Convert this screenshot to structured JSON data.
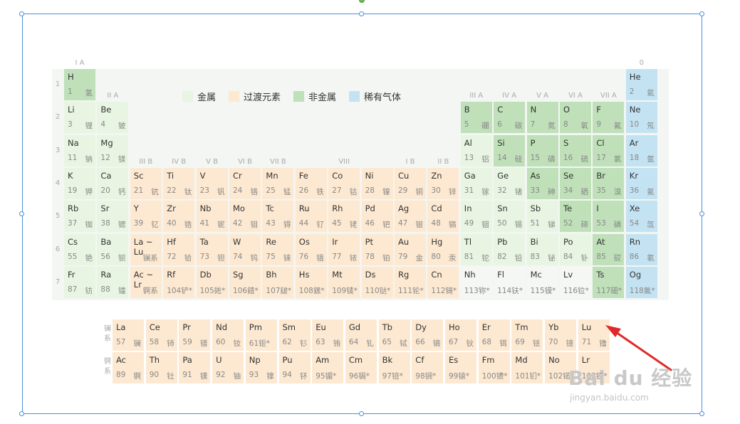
{
  "legend": [
    {
      "label": "金属",
      "color": "#e8f5e3"
    },
    {
      "label": "过渡元素",
      "color": "#fde9d1"
    },
    {
      "label": "非金属",
      "color": "#bfe0b9"
    },
    {
      "label": "稀有气体",
      "color": "#c3e3f3"
    }
  ],
  "group_labels": {
    "g1": "I A",
    "g2": "II A",
    "g3": "III B",
    "g4": "IV B",
    "g5": "V B",
    "g6": "VI B",
    "g7": "VII B",
    "g8": "VIII",
    "g11": "I B",
    "g12": "II B",
    "g13": "III A",
    "g14": "IV A",
    "g15": "V A",
    "g16": "VI A",
    "g17": "VII A",
    "g18": "0"
  },
  "periods": [
    "1",
    "2",
    "3",
    "4",
    "5",
    "6",
    "7"
  ],
  "series_labels": {
    "lanthanide": "镧系",
    "actinide": "锕系"
  },
  "elements": [
    {
      "symbol": "H",
      "number": "1",
      "name": "氢",
      "col": 1,
      "row": 1,
      "cat": "nonmetal"
    },
    {
      "symbol": "He",
      "number": "2",
      "name": "氦",
      "col": 18,
      "row": 1,
      "cat": "noble"
    },
    {
      "symbol": "Li",
      "number": "3",
      "name": "锂",
      "col": 1,
      "row": 2,
      "cat": "metal"
    },
    {
      "symbol": "Be",
      "number": "4",
      "name": "铍",
      "col": 2,
      "row": 2,
      "cat": "metal"
    },
    {
      "symbol": "B",
      "number": "5",
      "name": "硼",
      "col": 13,
      "row": 2,
      "cat": "nonmetal"
    },
    {
      "symbol": "C",
      "number": "6",
      "name": "碳",
      "col": 14,
      "row": 2,
      "cat": "nonmetal"
    },
    {
      "symbol": "N",
      "number": "7",
      "name": "氮",
      "col": 15,
      "row": 2,
      "cat": "nonmetal"
    },
    {
      "symbol": "O",
      "number": "8",
      "name": "氧",
      "col": 16,
      "row": 2,
      "cat": "nonmetal"
    },
    {
      "symbol": "F",
      "number": "9",
      "name": "氟",
      "col": 17,
      "row": 2,
      "cat": "nonmetal"
    },
    {
      "symbol": "Ne",
      "number": "10",
      "name": "氖",
      "col": 18,
      "row": 2,
      "cat": "noble"
    },
    {
      "symbol": "Na",
      "number": "11",
      "name": "钠",
      "col": 1,
      "row": 3,
      "cat": "metal"
    },
    {
      "symbol": "Mg",
      "number": "12",
      "name": "镁",
      "col": 2,
      "row": 3,
      "cat": "metal"
    },
    {
      "symbol": "Al",
      "number": "13",
      "name": "铝",
      "col": 13,
      "row": 3,
      "cat": "metal"
    },
    {
      "symbol": "Si",
      "number": "14",
      "name": "硅",
      "col": 14,
      "row": 3,
      "cat": "nonmetal"
    },
    {
      "symbol": "P",
      "number": "15",
      "name": "磷",
      "col": 15,
      "row": 3,
      "cat": "nonmetal"
    },
    {
      "symbol": "S",
      "number": "16",
      "name": "硫",
      "col": 16,
      "row": 3,
      "cat": "nonmetal"
    },
    {
      "symbol": "Cl",
      "number": "17",
      "name": "氯",
      "col": 17,
      "row": 3,
      "cat": "nonmetal"
    },
    {
      "symbol": "Ar",
      "number": "18",
      "name": "氩",
      "col": 18,
      "row": 3,
      "cat": "noble"
    },
    {
      "symbol": "K",
      "number": "19",
      "name": "钾",
      "col": 1,
      "row": 4,
      "cat": "metal"
    },
    {
      "symbol": "Ca",
      "number": "20",
      "name": "钙",
      "col": 2,
      "row": 4,
      "cat": "metal"
    },
    {
      "symbol": "Sc",
      "number": "21",
      "name": "钪",
      "col": 3,
      "row": 4,
      "cat": "transition"
    },
    {
      "symbol": "Ti",
      "number": "22",
      "name": "钛",
      "col": 4,
      "row": 4,
      "cat": "transition"
    },
    {
      "symbol": "V",
      "number": "23",
      "name": "钒",
      "col": 5,
      "row": 4,
      "cat": "transition"
    },
    {
      "symbol": "Cr",
      "number": "24",
      "name": "铬",
      "col": 6,
      "row": 4,
      "cat": "transition"
    },
    {
      "symbol": "Mn",
      "number": "25",
      "name": "锰",
      "col": 7,
      "row": 4,
      "cat": "transition"
    },
    {
      "symbol": "Fe",
      "number": "26",
      "name": "铁",
      "col": 8,
      "row": 4,
      "cat": "transition"
    },
    {
      "symbol": "Co",
      "number": "27",
      "name": "钴",
      "col": 9,
      "row": 4,
      "cat": "transition"
    },
    {
      "symbol": "Ni",
      "number": "28",
      "name": "镍",
      "col": 10,
      "row": 4,
      "cat": "transition"
    },
    {
      "symbol": "Cu",
      "number": "29",
      "name": "铜",
      "col": 11,
      "row": 4,
      "cat": "transition"
    },
    {
      "symbol": "Zn",
      "number": "30",
      "name": "锌",
      "col": 12,
      "row": 4,
      "cat": "transition"
    },
    {
      "symbol": "Ga",
      "number": "31",
      "name": "镓",
      "col": 13,
      "row": 4,
      "cat": "metal"
    },
    {
      "symbol": "Ge",
      "number": "32",
      "name": "锗",
      "col": 14,
      "row": 4,
      "cat": "metal"
    },
    {
      "symbol": "As",
      "number": "33",
      "name": "砷",
      "col": 15,
      "row": 4,
      "cat": "nonmetal"
    },
    {
      "symbol": "Se",
      "number": "34",
      "name": "硒",
      "col": 16,
      "row": 4,
      "cat": "nonmetal"
    },
    {
      "symbol": "Br",
      "number": "35",
      "name": "溴",
      "col": 17,
      "row": 4,
      "cat": "nonmetal"
    },
    {
      "symbol": "Kr",
      "number": "36",
      "name": "氪",
      "col": 18,
      "row": 4,
      "cat": "noble"
    },
    {
      "symbol": "Rb",
      "number": "37",
      "name": "铷",
      "col": 1,
      "row": 5,
      "cat": "metal"
    },
    {
      "symbol": "Sr",
      "number": "38",
      "name": "锶",
      "col": 2,
      "row": 5,
      "cat": "metal"
    },
    {
      "symbol": "Y",
      "number": "39",
      "name": "钇",
      "col": 3,
      "row": 5,
      "cat": "transition"
    },
    {
      "symbol": "Zr",
      "number": "40",
      "name": "锆",
      "col": 4,
      "row": 5,
      "cat": "transition"
    },
    {
      "symbol": "Nb",
      "number": "41",
      "name": "铌",
      "col": 5,
      "row": 5,
      "cat": "transition"
    },
    {
      "symbol": "Mo",
      "number": "42",
      "name": "钼",
      "col": 6,
      "row": 5,
      "cat": "transition"
    },
    {
      "symbol": "Tc",
      "number": "43",
      "name": "锝",
      "col": 7,
      "row": 5,
      "cat": "transition"
    },
    {
      "symbol": "Ru",
      "number": "44",
      "name": "钌",
      "col": 8,
      "row": 5,
      "cat": "transition"
    },
    {
      "symbol": "Rh",
      "number": "45",
      "name": "铑",
      "col": 9,
      "row": 5,
      "cat": "transition"
    },
    {
      "symbol": "Pd",
      "number": "46",
      "name": "钯",
      "col": 10,
      "row": 5,
      "cat": "transition"
    },
    {
      "symbol": "Ag",
      "number": "47",
      "name": "银",
      "col": 11,
      "row": 5,
      "cat": "transition"
    },
    {
      "symbol": "Cd",
      "number": "48",
      "name": "镉",
      "col": 12,
      "row": 5,
      "cat": "transition"
    },
    {
      "symbol": "In",
      "number": "49",
      "name": "铟",
      "col": 13,
      "row": 5,
      "cat": "metal"
    },
    {
      "symbol": "Sn",
      "number": "50",
      "name": "锡",
      "col": 14,
      "row": 5,
      "cat": "metal"
    },
    {
      "symbol": "Sb",
      "number": "51",
      "name": "锑",
      "col": 15,
      "row": 5,
      "cat": "metal"
    },
    {
      "symbol": "Te",
      "number": "52",
      "name": "碲",
      "col": 16,
      "row": 5,
      "cat": "nonmetal"
    },
    {
      "symbol": "I",
      "number": "53",
      "name": "碘",
      "col": 17,
      "row": 5,
      "cat": "nonmetal"
    },
    {
      "symbol": "Xe",
      "number": "54",
      "name": "氙",
      "col": 18,
      "row": 5,
      "cat": "noble"
    },
    {
      "symbol": "Cs",
      "number": "55",
      "name": "铯",
      "col": 1,
      "row": 6,
      "cat": "metal"
    },
    {
      "symbol": "Ba",
      "number": "56",
      "name": "钡",
      "col": 2,
      "row": 6,
      "cat": "metal"
    },
    {
      "symbol": "La ~ Lu",
      "number": "",
      "name": "镧系",
      "col": 3,
      "row": 6,
      "cat": "placeholder"
    },
    {
      "symbol": "Hf",
      "number": "72",
      "name": "铪",
      "col": 4,
      "row": 6,
      "cat": "transition"
    },
    {
      "symbol": "Ta",
      "number": "73",
      "name": "钽",
      "col": 5,
      "row": 6,
      "cat": "transition"
    },
    {
      "symbol": "W",
      "number": "74",
      "name": "钨",
      "col": 6,
      "row": 6,
      "cat": "transition"
    },
    {
      "symbol": "Re",
      "number": "75",
      "name": "铼",
      "col": 7,
      "row": 6,
      "cat": "transition"
    },
    {
      "symbol": "Os",
      "number": "76",
      "name": "锇",
      "col": 8,
      "row": 6,
      "cat": "transition"
    },
    {
      "symbol": "Ir",
      "number": "77",
      "name": "铱",
      "col": 9,
      "row": 6,
      "cat": "transition"
    },
    {
      "symbol": "Pt",
      "number": "78",
      "name": "铂",
      "col": 10,
      "row": 6,
      "cat": "transition"
    },
    {
      "symbol": "Au",
      "number": "79",
      "name": "金",
      "col": 11,
      "row": 6,
      "cat": "transition"
    },
    {
      "symbol": "Hg",
      "number": "80",
      "name": "汞",
      "col": 12,
      "row": 6,
      "cat": "transition"
    },
    {
      "symbol": "Tl",
      "number": "81",
      "name": "铊",
      "col": 13,
      "row": 6,
      "cat": "metal"
    },
    {
      "symbol": "Pb",
      "number": "82",
      "name": "铅",
      "col": 14,
      "row": 6,
      "cat": "metal"
    },
    {
      "symbol": "Bi",
      "number": "83",
      "name": "铋",
      "col": 15,
      "row": 6,
      "cat": "metal"
    },
    {
      "symbol": "Po",
      "number": "84",
      "name": "钋",
      "col": 16,
      "row": 6,
      "cat": "metal"
    },
    {
      "symbol": "At",
      "number": "85",
      "name": "砹",
      "col": 17,
      "row": 6,
      "cat": "nonmetal"
    },
    {
      "symbol": "Rn",
      "number": "86",
      "name": "氡",
      "col": 18,
      "row": 6,
      "cat": "noble"
    },
    {
      "symbol": "Fr",
      "number": "87",
      "name": "钫",
      "col": 1,
      "row": 7,
      "cat": "metal"
    },
    {
      "symbol": "Ra",
      "number": "88",
      "name": "镭",
      "col": 2,
      "row": 7,
      "cat": "metal"
    },
    {
      "symbol": "Ac ~ Lr",
      "number": "",
      "name": "锕系",
      "col": 3,
      "row": 7,
      "cat": "placeholder"
    },
    {
      "symbol": "Rf",
      "number": "104",
      "name": "铲*",
      "col": 4,
      "row": 7,
      "cat": "transition",
      "inline": true
    },
    {
      "symbol": "Db",
      "number": "105",
      "name": "𨧀*",
      "col": 5,
      "row": 7,
      "cat": "transition",
      "inline": true
    },
    {
      "symbol": "Sg",
      "number": "106",
      "name": "𨭎*",
      "col": 6,
      "row": 7,
      "cat": "transition",
      "inline": true
    },
    {
      "symbol": "Bh",
      "number": "107",
      "name": "𨨏*",
      "col": 7,
      "row": 7,
      "cat": "transition",
      "inline": true
    },
    {
      "symbol": "Hs",
      "number": "108",
      "name": "𨭆*",
      "col": 8,
      "row": 7,
      "cat": "transition",
      "inline": true
    },
    {
      "symbol": "Mt",
      "number": "109",
      "name": "鿏*",
      "col": 9,
      "row": 7,
      "cat": "transition",
      "inline": true
    },
    {
      "symbol": "Ds",
      "number": "110",
      "name": "𫟼*",
      "col": 10,
      "row": 7,
      "cat": "transition",
      "inline": true
    },
    {
      "symbol": "Rg",
      "number": "111",
      "name": "𬬭*",
      "col": 11,
      "row": 7,
      "cat": "transition",
      "inline": true
    },
    {
      "symbol": "Cn",
      "number": "112",
      "name": "鿔*",
      "col": 12,
      "row": 7,
      "cat": "transition",
      "inline": true
    },
    {
      "symbol": "Nh",
      "number": "113",
      "name": "鿭*",
      "col": 13,
      "row": 7,
      "cat": "unknown",
      "inline": true
    },
    {
      "symbol": "Fl",
      "number": "114",
      "name": "𫓧*",
      "col": 14,
      "row": 7,
      "cat": "unknown",
      "inline": true
    },
    {
      "symbol": "Mc",
      "number": "115",
      "name": "镆*",
      "col": 15,
      "row": 7,
      "cat": "unknown",
      "inline": true
    },
    {
      "symbol": "Lv",
      "number": "116",
      "name": "𫟷*",
      "col": 16,
      "row": 7,
      "cat": "unknown",
      "inline": true
    },
    {
      "symbol": "Ts",
      "number": "117",
      "name": "鿬*",
      "col": 17,
      "row": 7,
      "cat": "nonmetal",
      "inline": true
    },
    {
      "symbol": "Og",
      "number": "118",
      "name": "鿫*",
      "col": 18,
      "row": 7,
      "cat": "noble",
      "inline": true
    }
  ],
  "lanthanides": [
    {
      "symbol": "La",
      "number": "57",
      "name": "镧"
    },
    {
      "symbol": "Ce",
      "number": "58",
      "name": "铈"
    },
    {
      "symbol": "Pr",
      "number": "59",
      "name": "镨"
    },
    {
      "symbol": "Nd",
      "number": "60",
      "name": "钕"
    },
    {
      "symbol": "Pm",
      "number": "61",
      "name": "钷*",
      "inline": true
    },
    {
      "symbol": "Sm",
      "number": "62",
      "name": "钐"
    },
    {
      "symbol": "Eu",
      "number": "63",
      "name": "铕"
    },
    {
      "symbol": "Gd",
      "number": "64",
      "name": "钆"
    },
    {
      "symbol": "Tb",
      "number": "65",
      "name": "铽"
    },
    {
      "symbol": "Dy",
      "number": "66",
      "name": "镝"
    },
    {
      "symbol": "Ho",
      "number": "67",
      "name": "钬"
    },
    {
      "symbol": "Er",
      "number": "68",
      "name": "铒"
    },
    {
      "symbol": "Tm",
      "number": "69",
      "name": "铥"
    },
    {
      "symbol": "Yb",
      "number": "70",
      "name": "镱"
    },
    {
      "symbol": "Lu",
      "number": "71",
      "name": "镥"
    }
  ],
  "actinides": [
    {
      "symbol": "Ac",
      "number": "89",
      "name": "锕"
    },
    {
      "symbol": "Th",
      "number": "90",
      "name": "钍"
    },
    {
      "symbol": "Pa",
      "number": "91",
      "name": "镤"
    },
    {
      "symbol": "U",
      "number": "92",
      "name": "铀"
    },
    {
      "symbol": "Np",
      "number": "93",
      "name": "镎"
    },
    {
      "symbol": "Pu",
      "number": "94",
      "name": "钚"
    },
    {
      "symbol": "Am",
      "number": "95",
      "name": "镅*",
      "inline": true
    },
    {
      "symbol": "Cm",
      "number": "96",
      "name": "锔*",
      "inline": true
    },
    {
      "symbol": "Bk",
      "number": "97",
      "name": "锫*",
      "inline": true
    },
    {
      "symbol": "Cf",
      "number": "98",
      "name": "锎*",
      "inline": true
    },
    {
      "symbol": "Es",
      "number": "99",
      "name": "锿*",
      "inline": true
    },
    {
      "symbol": "Fm",
      "number": "100",
      "name": "镄*",
      "inline": true
    },
    {
      "symbol": "Md",
      "number": "101",
      "name": "钔*",
      "inline": true
    },
    {
      "symbol": "No",
      "number": "102",
      "name": "锘*",
      "inline": true
    },
    {
      "symbol": "Lr",
      "number": "103",
      "name": "铹*",
      "inline": true
    }
  ],
  "watermark": {
    "logo": "Bai du 经验",
    "url": "jingyan.baidu.com"
  },
  "colors": {
    "selection": "#4a90d9",
    "arrow": "#e02a2a",
    "rotate_handle": "#6abf4b"
  }
}
